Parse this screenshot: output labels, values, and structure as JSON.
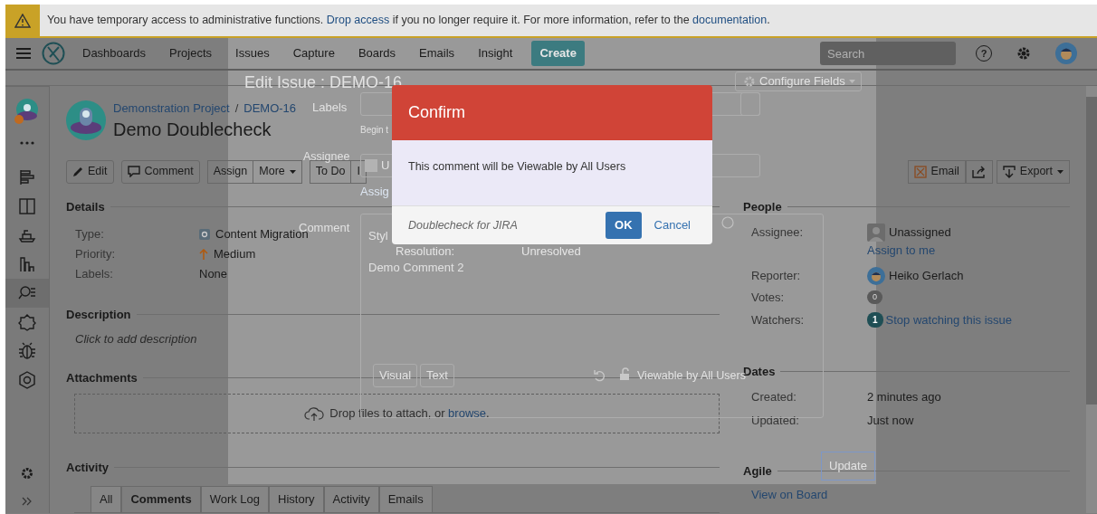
{
  "banner": {
    "parts": [
      {
        "kind": "text",
        "text": "You have temporary access to administrative functions. "
      },
      {
        "kind": "link",
        "text": "Drop access"
      },
      {
        "kind": "text",
        "text": " if you no longer require it. For more information, refer to the "
      },
      {
        "kind": "link",
        "text": "documentation"
      },
      {
        "kind": "text",
        "text": "."
      }
    ]
  },
  "nav": {
    "items": [
      "Dashboards",
      "Projects",
      "Issues",
      "Capture",
      "Boards",
      "Emails",
      "Insight"
    ],
    "create": "Create",
    "search": {
      "placeholder": "Search"
    },
    "help": "?"
  },
  "sidebar": {
    "items": [
      {
        "kind": "backlog",
        "selected": false
      },
      {
        "kind": "board",
        "selected": false
      },
      {
        "kind": "releases",
        "selected": false
      },
      {
        "kind": "reports",
        "selected": false
      },
      {
        "kind": "issues",
        "selected": true
      },
      {
        "kind": "components",
        "selected": false
      },
      {
        "kind": "bugs",
        "selected": false
      },
      {
        "kind": "addons",
        "selected": false
      }
    ]
  },
  "issue": {
    "project": "Demonstration Project",
    "separator": "/",
    "key": "DEMO-16",
    "title": "Demo Doublecheck"
  },
  "actions": [
    {
      "kind": "edit",
      "label": "Edit"
    },
    {
      "kind": "comment",
      "label": "Comment"
    },
    {
      "kind": "plain",
      "label": "Assign"
    },
    {
      "kind": "menu",
      "label": "More"
    },
    {
      "kind": "plain",
      "label": "To Do"
    },
    {
      "kind": "plain",
      "label": "I"
    }
  ],
  "right_actions": [
    {
      "kind": "email",
      "label": "Email"
    },
    {
      "kind": "share"
    },
    {
      "kind": "export",
      "label": "Export"
    }
  ],
  "details": {
    "heading": "Details",
    "fields": [
      {
        "kind": "type",
        "label": "Type:",
        "value": "Content Migration"
      },
      {
        "kind": "priority",
        "label": "Priority:",
        "value": "Medium"
      },
      {
        "kind": "plain",
        "label": "Labels:",
        "value": "None"
      }
    ]
  },
  "description": {
    "heading": "Description",
    "hint": "Click to add description"
  },
  "attachments": {
    "heading": "Attachments",
    "text": "Drop files to attach, or ",
    "link": "browse",
    "after": "."
  },
  "activity": {
    "heading": "Activity",
    "tabs": [
      {
        "label": "All",
        "selected": false
      },
      {
        "label": "Comments",
        "selected": true
      },
      {
        "label": "Work Log",
        "selected": false
      },
      {
        "label": "History",
        "selected": false
      },
      {
        "label": "Activity",
        "selected": false
      },
      {
        "label": "Emails",
        "selected": false
      }
    ]
  },
  "people": {
    "heading": "People",
    "assignee_label": "Assignee:",
    "assignee": "Unassigned",
    "assign_link": "Assign to me",
    "reporter_label": "Reporter:",
    "reporter": "Heiko Gerlach",
    "votes_label": "Votes:",
    "votes": "0",
    "watchers_label": "Watchers:",
    "watchers": "1",
    "watch_link": "Stop watching this issue"
  },
  "dates": {
    "heading": "Dates",
    "rows": [
      {
        "label": "Created:",
        "value": "2 minutes ago"
      },
      {
        "label": "Updated:",
        "value": "Just now"
      }
    ]
  },
  "agile": {
    "heading": "Agile",
    "link": "View on Board"
  },
  "edit_dialog": {
    "title": "Edit Issue : DEMO-16",
    "configure": "Configure Fields",
    "labels_label": "Labels",
    "labels_hint": "Begin t",
    "assignee_label": "Assignee",
    "assignee_value": "U",
    "assign_link": "Assig",
    "comment_label": "Comment",
    "style": "Styl",
    "resolution_label": "Resolution:",
    "resolution_value": "Unresolved",
    "comment_text": "Demo Comment 2",
    "editor_tabs": [
      "Visual",
      "Text"
    ],
    "visibility": "Viewable by All Users",
    "update": "Update"
  },
  "confirm": {
    "title": "Confirm",
    "message": "This comment will be Viewable by All Users",
    "footer": "Doublecheck for JIRA",
    "ok": "OK",
    "cancel": "Cancel"
  }
}
